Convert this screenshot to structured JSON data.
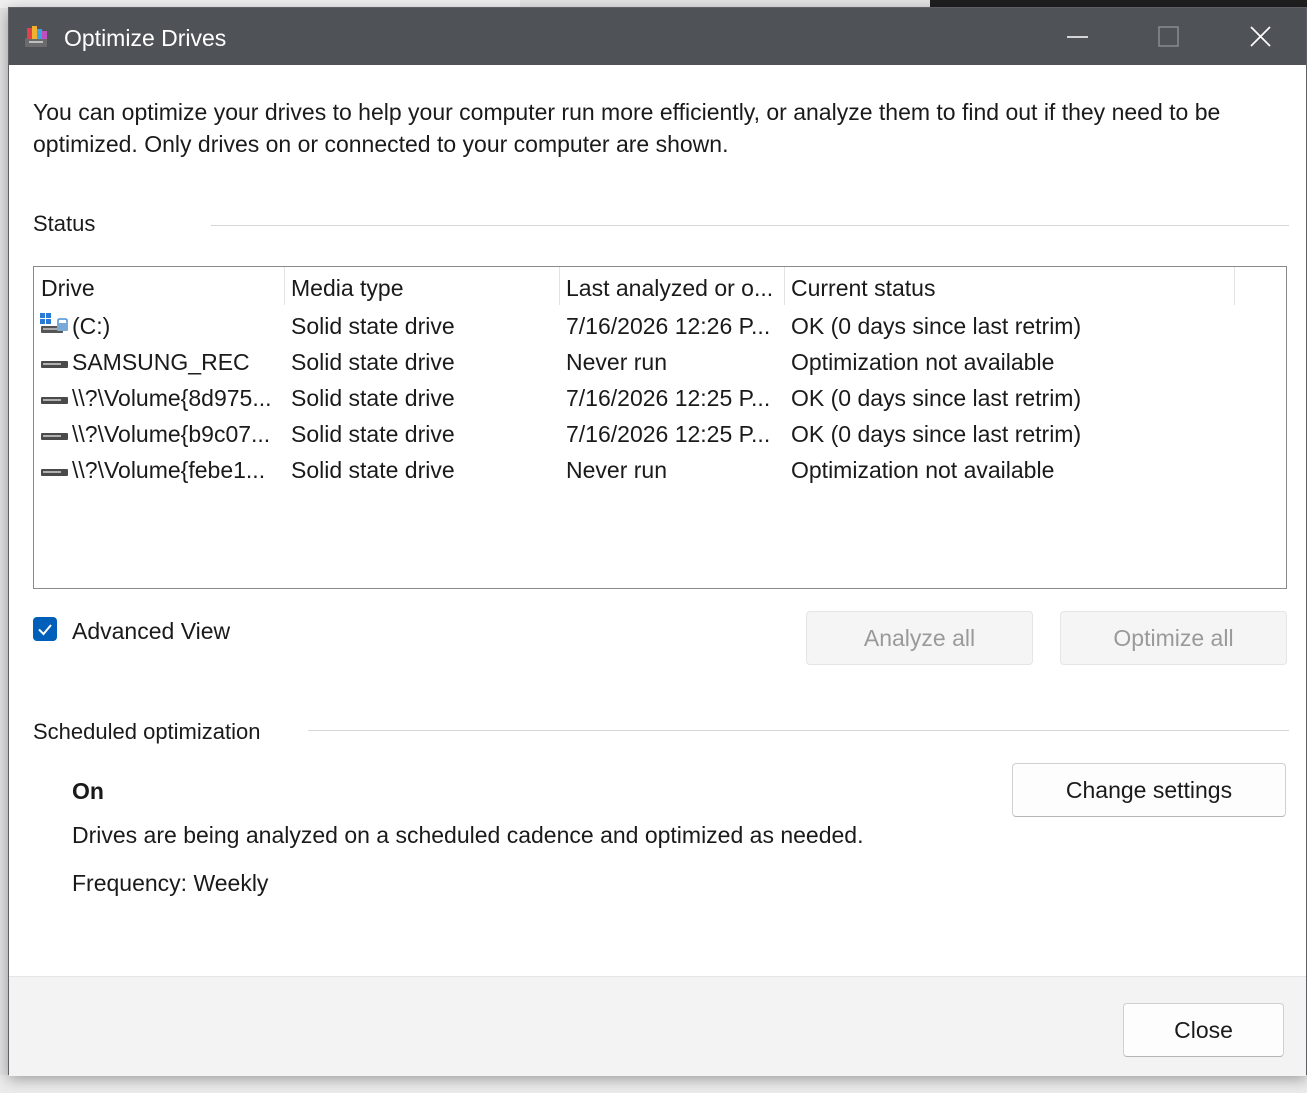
{
  "window": {
    "title": "Optimize Drives"
  },
  "intro_text": "You can optimize your drives to help your computer run more efficiently, or analyze them to find out if they need to be optimized. Only drives on or connected to your computer are shown.",
  "status_section": {
    "label": "Status",
    "columns": [
      "Drive",
      "Media type",
      "Last analyzed or o...",
      "Current status"
    ],
    "rows": [
      {
        "icon": "windows-drive-icon",
        "drive": "(C:)",
        "media": "Solid state drive",
        "last": "7/16/2026 12:26 P...",
        "status": "OK (0 days since last retrim)"
      },
      {
        "icon": "drive-icon",
        "drive": "SAMSUNG_REC",
        "media": "Solid state drive",
        "last": "Never run",
        "status": "Optimization not available"
      },
      {
        "icon": "drive-icon",
        "drive": "\\\\?\\Volume{8d975...",
        "media": "Solid state drive",
        "last": "7/16/2026 12:25 P...",
        "status": "OK (0 days since last retrim)"
      },
      {
        "icon": "drive-icon",
        "drive": "\\\\?\\Volume{b9c07...",
        "media": "Solid state drive",
        "last": "7/16/2026 12:25 P...",
        "status": "OK (0 days since last retrim)"
      },
      {
        "icon": "drive-icon",
        "drive": "\\\\?\\Volume{febe1...",
        "media": "Solid state drive",
        "last": "Never run",
        "status": "Optimization not available"
      }
    ]
  },
  "advanced_view": {
    "label": "Advanced View",
    "checked": true
  },
  "buttons": {
    "analyze_all": "Analyze all",
    "optimize_all": "Optimize all",
    "change_settings": "Change settings",
    "close": "Close"
  },
  "scheduled": {
    "label": "Scheduled optimization",
    "status": "On",
    "description": "Drives are being analyzed on a scheduled cadence and optimized as needed.",
    "frequency": "Frequency: Weekly"
  },
  "colors": {
    "titlebar": "#4f5358",
    "accent": "#005fb8"
  }
}
